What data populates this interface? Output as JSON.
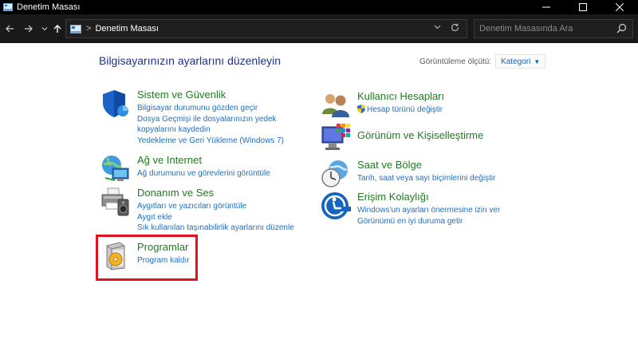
{
  "window": {
    "title": "Denetim Masası"
  },
  "address": {
    "crumb": "Denetim Masası"
  },
  "search": {
    "placeholder": "Denetim Masasında Ara"
  },
  "header": {
    "title": "Bilgisayarınızın ayarlarını düzenleyin",
    "view_by_label": "Görüntüleme ölçütü:",
    "view_by_value": "Kategori"
  },
  "categories_left": [
    {
      "title": "Sistem ve Güvenlik",
      "icon": "shield-icon",
      "links": [
        "Bilgisayar durumunu gözden geçir",
        "Dosya Geçmişi ile dosyalarınızın yedek kopyalarını kaydedin",
        "Yedekleme ve Geri Yükleme (Windows 7)"
      ]
    },
    {
      "title": "Ağ ve Internet",
      "icon": "globe-network-icon",
      "links": [
        "Ağ durumunu ve görevlerini görüntüle"
      ]
    },
    {
      "title": "Donanım ve Ses",
      "icon": "printer-speaker-icon",
      "links": [
        "Aygıtları ve yazıcıları görüntüle",
        "Aygıt ekle",
        "Sık kullanılan taşınabilirlik ayarlarını düzenle"
      ]
    },
    {
      "title": "Programlar",
      "icon": "programs-disc-icon",
      "links": [
        "Program kaldır"
      ]
    }
  ],
  "categories_right": [
    {
      "title": "Kullanıcı Hesapları",
      "icon": "users-icon",
      "links": [
        "Hesap türünü değiştir"
      ]
    },
    {
      "title": "Görünüm ve Kişiselleştirme",
      "icon": "monitor-palette-icon",
      "links": []
    },
    {
      "title": "Saat ve Bölge",
      "icon": "clock-globe-icon",
      "links": [
        "Tarih, saat veya sayı biçimlerini değiştir"
      ]
    },
    {
      "title": "Erişim Kolaylığı",
      "icon": "accessibility-icon",
      "links": [
        "Windows'un ayarları önermesine izin ver",
        "Görünümü en iyi duruma getir"
      ]
    }
  ],
  "colors": {
    "heading": "#217a21",
    "link": "#1e6fc2",
    "title": "#1e3287",
    "highlight": "#e0141e"
  }
}
